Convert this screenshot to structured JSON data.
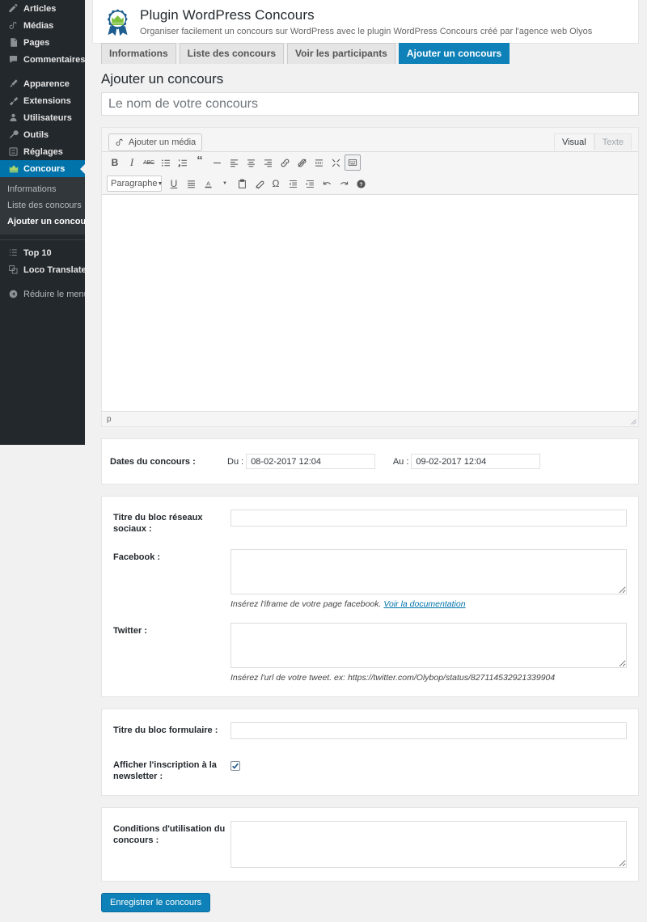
{
  "sidebar": {
    "items": [
      {
        "label": "Articles",
        "icon": "post-icon",
        "current": false
      },
      {
        "label": "Médias",
        "icon": "media-icon",
        "current": false
      },
      {
        "label": "Pages",
        "icon": "page-icon",
        "current": false
      },
      {
        "label": "Commentaires",
        "icon": "comments-icon",
        "current": false
      },
      {
        "label": "Apparence",
        "icon": "appearance-icon",
        "current": false
      },
      {
        "label": "Extensions",
        "icon": "plugins-icon",
        "current": false
      },
      {
        "label": "Utilisateurs",
        "icon": "users-icon",
        "current": false
      },
      {
        "label": "Outils",
        "icon": "tools-icon",
        "current": false
      },
      {
        "label": "Réglages",
        "icon": "settings-icon",
        "current": false
      },
      {
        "label": "Concours",
        "icon": "crown-icon",
        "current": true
      }
    ],
    "submenu": [
      {
        "label": "Informations",
        "current": false
      },
      {
        "label": "Liste des concours",
        "current": false
      },
      {
        "label": "Ajouter un concours",
        "current": true
      }
    ],
    "extra_items": [
      {
        "label": "Top 10",
        "icon": "list-icon"
      },
      {
        "label": "Loco Translate",
        "icon": "translate-icon"
      }
    ],
    "collapse": {
      "label": "Réduire le menu",
      "icon": "collapse-icon"
    }
  },
  "plugin_header": {
    "logo_icon": "award-rosette-icon",
    "title": "Plugin WordPress Concours",
    "subtitle": "Organiser facilement un concours sur WordPress avec le plugin WordPress Concours créé par l'agence web Olyos"
  },
  "tabs": [
    {
      "label": "Informations",
      "active": false
    },
    {
      "label": "Liste des concours",
      "active": false
    },
    {
      "label": "Voir les participants",
      "active": false
    },
    {
      "label": "Ajouter un concours",
      "active": true
    }
  ],
  "page": {
    "title": "Ajouter un concours"
  },
  "title_field": {
    "value": "",
    "placeholder": "Le nom de votre concours"
  },
  "editor": {
    "add_media_label": "Ajouter un média",
    "add_media_icon": "media-icon",
    "mode_tabs": [
      {
        "label": "Visual",
        "active": true
      },
      {
        "label": "Texte",
        "active": false
      }
    ],
    "toolbar_row1": [
      {
        "icon": "bold-icon",
        "glyph": "B",
        "boxed": false
      },
      {
        "icon": "italic-icon",
        "glyph": "I",
        "boxed": false
      },
      {
        "icon": "strikethrough-icon",
        "glyph": "ABC",
        "boxed": false
      },
      {
        "icon": "bullet-list-icon",
        "glyph": "",
        "boxed": false
      },
      {
        "icon": "numbered-list-icon",
        "glyph": "",
        "boxed": false
      },
      {
        "icon": "blockquote-icon",
        "glyph": "“",
        "boxed": false
      },
      {
        "icon": "horizontal-rule-icon",
        "glyph": "—",
        "boxed": false
      },
      {
        "icon": "align-left-icon",
        "glyph": "",
        "boxed": false
      },
      {
        "icon": "align-center-icon",
        "glyph": "",
        "boxed": false
      },
      {
        "icon": "align-right-icon",
        "glyph": "",
        "boxed": false
      },
      {
        "icon": "link-icon",
        "glyph": "",
        "boxed": false
      },
      {
        "icon": "unlink-icon",
        "glyph": "",
        "boxed": false
      },
      {
        "icon": "read-more-icon",
        "glyph": "",
        "boxed": false
      },
      {
        "icon": "distraction-free-icon",
        "glyph": "",
        "boxed": false
      },
      {
        "icon": "toggle-toolbar-icon",
        "glyph": "",
        "boxed": true
      }
    ],
    "format_select": {
      "value": "Paragraphe"
    },
    "toolbar_row2": [
      {
        "icon": "underline-icon",
        "glyph": "U",
        "boxed": false
      },
      {
        "icon": "align-justify-icon",
        "glyph": "",
        "boxed": false
      },
      {
        "icon": "text-color-icon",
        "glyph": "A",
        "boxed": false
      },
      {
        "icon": "text-color-caret-icon",
        "glyph": "",
        "boxed": false
      },
      {
        "icon": "paste-as-text-icon",
        "glyph": "",
        "boxed": false
      },
      {
        "icon": "clear-formatting-icon",
        "glyph": "",
        "boxed": false
      },
      {
        "icon": "special-character-icon",
        "glyph": "Ω",
        "boxed": false
      },
      {
        "icon": "outdent-icon",
        "glyph": "",
        "boxed": false
      },
      {
        "icon": "indent-icon",
        "glyph": "",
        "boxed": false
      },
      {
        "icon": "undo-icon",
        "glyph": "",
        "boxed": false
      },
      {
        "icon": "redo-icon",
        "glyph": "",
        "boxed": false
      },
      {
        "icon": "keyboard-shortcuts-icon",
        "glyph": "",
        "boxed": false
      }
    ],
    "content": "",
    "statusbar_path": "p"
  },
  "dates_panel": {
    "label": "Dates du concours :",
    "from_label": "Du :",
    "from_value": "08-02-2017 12:04",
    "to_label": "Au :",
    "to_value": "09-02-2017 12:04"
  },
  "social_panel": {
    "block_title_label": "Titre du bloc réseaux sociaux :",
    "block_title_value": "",
    "facebook_label": "Facebook :",
    "facebook_value": "",
    "facebook_hint": "Insérez l'iframe de votre page facebook.",
    "facebook_hint_link": "Voir la documentation",
    "twitter_label": "Twitter :",
    "twitter_value": "",
    "twitter_hint": "Insérez l'url de votre tweet. ex: https://twitter.com/Olybop/status/827114532921339904"
  },
  "form_panel": {
    "block_title_label": "Titre du bloc formulaire :",
    "block_title_value": "",
    "newsletter_label": "Afficher l'inscription à la newsletter :",
    "newsletter_checked": true
  },
  "conditions_panel": {
    "label": "Conditions d'utilisation du concours :",
    "value": ""
  },
  "submit": {
    "label": "Enregistrer le concours"
  },
  "colors": {
    "accent": "#0d81b8",
    "sidebar_bg": "#23282d",
    "submenu_bg": "#32373c",
    "page_bg": "#f1f1f1",
    "crown_green": "#7cc03c",
    "ribbon_blue": "#1d5d8f"
  }
}
